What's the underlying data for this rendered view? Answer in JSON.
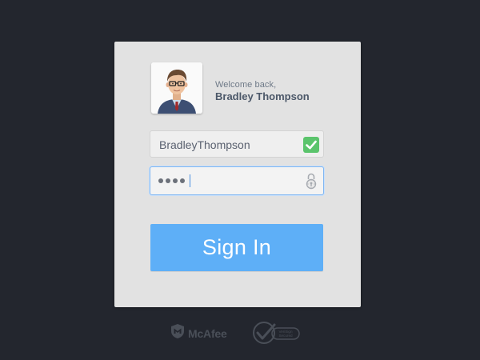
{
  "login": {
    "welcome_text": "Welcome back,",
    "user_display_name": "Bradley Thompson",
    "username_value": "BradleyThompson",
    "password_masked_length": 4,
    "signin_label": "Sign In"
  },
  "badges": {
    "mcafee_label": "McAfee",
    "verisign_label": "VeriSign Secured"
  },
  "colors": {
    "background": "#23262e",
    "card": "#e2e2e2",
    "accent_button": "#5eaff7",
    "check_green": "#5bc46c",
    "focus_border": "#7fb6f2"
  },
  "icons": {
    "avatar": "user-avatar",
    "valid": "checkmark-icon",
    "lock": "lock-icon",
    "mcafee": "mcafee-shield-icon",
    "verisign": "verisign-check-icon"
  }
}
